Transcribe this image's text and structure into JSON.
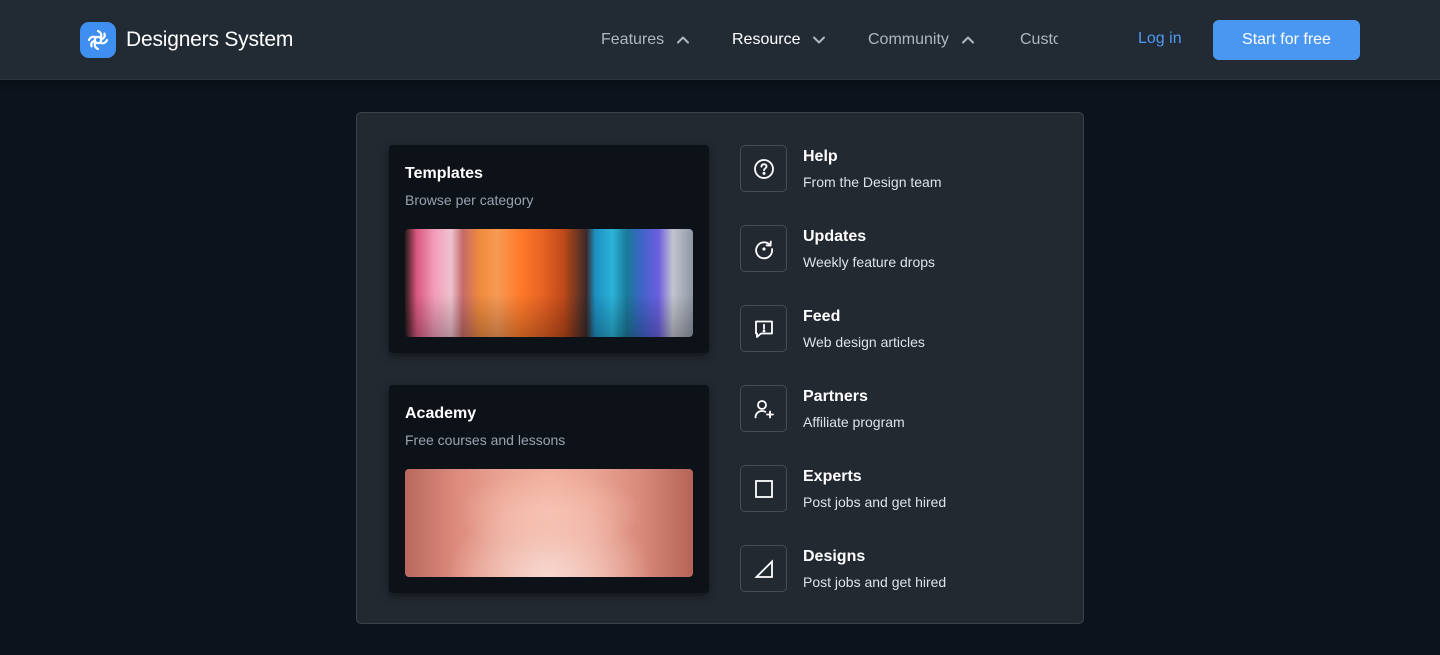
{
  "brand": {
    "name": "Designers System",
    "accent": "#4a97f2"
  },
  "nav": {
    "items": [
      {
        "label": "Features",
        "icon": "chevron-up-icon"
      },
      {
        "label": "Resource",
        "icon": "chevron-down-icon"
      },
      {
        "label": "Community",
        "icon": "chevron-up-icon"
      },
      {
        "label": "Customers"
      }
    ],
    "login_label": "Log in",
    "cta_label": "Start for free"
  },
  "dropdown": {
    "cards": [
      {
        "title": "Templates",
        "subtitle": "Browse per category"
      },
      {
        "title": "Academy",
        "subtitle": "Free courses and lessons"
      }
    ],
    "items": [
      {
        "title": "Help",
        "subtitle": "From the Design team",
        "icon": "question-circle-icon"
      },
      {
        "title": "Updates",
        "subtitle": "Weekly feature drops",
        "icon": "refresh-icon"
      },
      {
        "title": "Feed",
        "subtitle": "Web design articles",
        "icon": "message-alert-icon"
      },
      {
        "title": "Partners",
        "subtitle": "Affiliate program",
        "icon": "user-plus-icon"
      },
      {
        "title": "Experts",
        "subtitle": "Post jobs and get hired",
        "icon": "square-icon"
      },
      {
        "title": "Designs",
        "subtitle": "Post jobs and get hired",
        "icon": "triangle-icon"
      }
    ]
  }
}
